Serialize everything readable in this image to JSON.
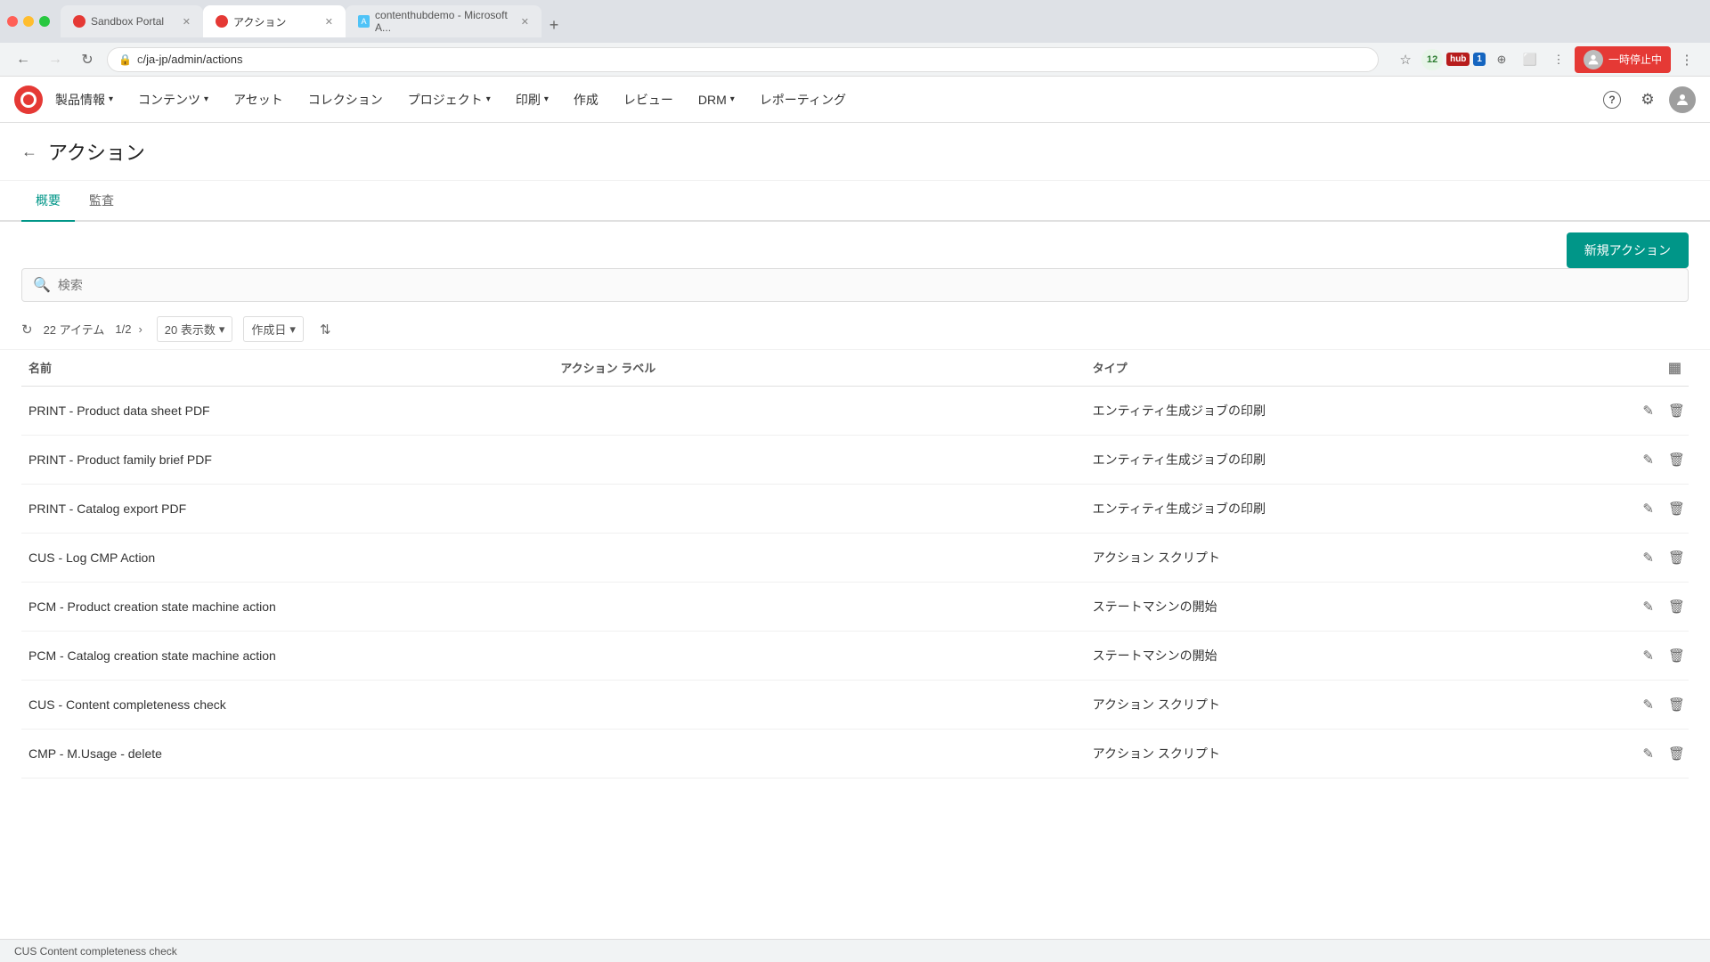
{
  "browser": {
    "tabs": [
      {
        "id": "tab1",
        "label": "Sandbox Portal",
        "active": false,
        "favicon_color": "#e53935"
      },
      {
        "id": "tab2",
        "label": "アクション",
        "active": true,
        "favicon_color": "#e53935"
      },
      {
        "id": "tab3",
        "label": "contenthubdemo - Microsoft A...",
        "active": false,
        "favicon_color": "#4fc3f7"
      }
    ],
    "address": "c",
    "url": "/ja-jp/admin/actions",
    "new_tab_icon": "+"
  },
  "header": {
    "logo_alt": "App Logo",
    "nav_items": [
      {
        "label": "製品情報",
        "has_dropdown": true
      },
      {
        "label": "コンテンツ",
        "has_dropdown": true
      },
      {
        "label": "アセット",
        "has_dropdown": false
      },
      {
        "label": "コレクション",
        "has_dropdown": false
      },
      {
        "label": "プロジェクト",
        "has_dropdown": true
      },
      {
        "label": "印刷",
        "has_dropdown": true
      },
      {
        "label": "作成",
        "has_dropdown": false
      },
      {
        "label": "レビュー",
        "has_dropdown": false
      },
      {
        "label": "DRM",
        "has_dropdown": true
      },
      {
        "label": "レポーティング",
        "has_dropdown": false
      }
    ],
    "help_icon": "?",
    "settings_icon": "⚙",
    "user_label": "一時停止中",
    "pause_icon": "⏸"
  },
  "page": {
    "back_label": "←",
    "title": "アクション",
    "tabs": [
      {
        "label": "概要",
        "active": true
      },
      {
        "label": "監査",
        "active": false
      }
    ],
    "new_action_button": "新規アクション",
    "search_placeholder": "検索",
    "item_count": "22 アイテム",
    "pagination": "1/2",
    "display_count": "20 表示数",
    "sort_label": "作成日",
    "filter_icon": "⇅",
    "columns_icon": "▦",
    "table": {
      "headers": [
        {
          "label": "名前"
        },
        {
          "label": "アクション ラベル"
        },
        {
          "label": "タイプ"
        },
        {
          "label": ""
        }
      ],
      "rows": [
        {
          "name": "PRINT - Product data sheet PDF",
          "action_label": "",
          "type": "エンティティ生成ジョブの印刷"
        },
        {
          "name": "PRINT - Product family brief PDF",
          "action_label": "",
          "type": "エンティティ生成ジョブの印刷"
        },
        {
          "name": "PRINT - Catalog export PDF",
          "action_label": "",
          "type": "エンティティ生成ジョブの印刷"
        },
        {
          "name": "CUS - Log CMP Action",
          "action_label": "",
          "type": "アクション スクリプト"
        },
        {
          "name": "PCM - Product creation state machine action",
          "action_label": "",
          "type": "ステートマシンの開始"
        },
        {
          "name": "PCM - Catalog creation state machine action",
          "action_label": "",
          "type": "ステートマシンの開始"
        },
        {
          "name": "CUS - Content completeness check",
          "action_label": "",
          "type": "アクション スクリプト"
        },
        {
          "name": "CMP - M.Usage - delete",
          "action_label": "",
          "type": "アクション スクリプト"
        }
      ],
      "edit_icon": "✎",
      "delete_icon": "🗑"
    }
  },
  "status_bar": {
    "label": "CUS Content completeness check"
  }
}
